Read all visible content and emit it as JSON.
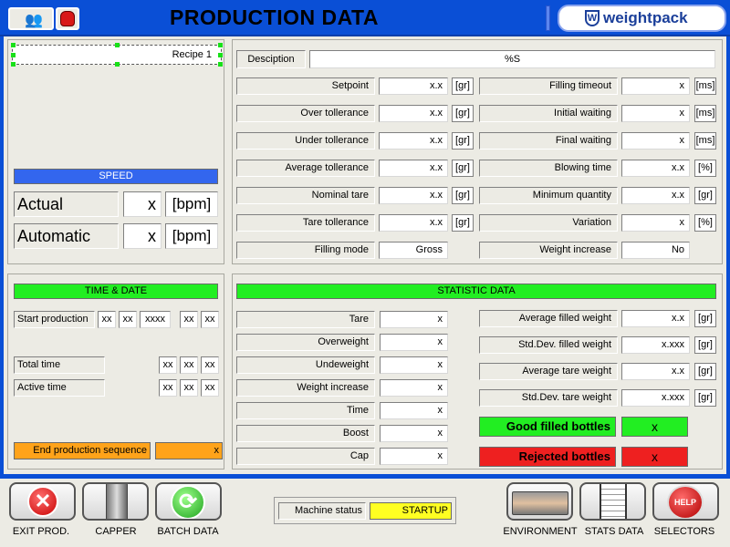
{
  "header": {
    "title": "PRODUCTION DATA",
    "logo": "weightpack"
  },
  "recipe": {
    "value": "Recipe 1"
  },
  "speed": {
    "title": "SPEED",
    "actual_label": "Actual",
    "actual_value": "x",
    "actual_unit": "[bpm]",
    "automatic_label": "Automatic",
    "automatic_value": "x",
    "automatic_unit": "[bpm]"
  },
  "timedate": {
    "title": "TIME & DATE",
    "start_label": "Start production",
    "start_values": [
      "xx",
      "xx",
      "xxxx",
      "xx",
      "xx"
    ],
    "total_label": "Total time",
    "total_values": [
      "xx",
      "xx",
      "xx"
    ],
    "active_label": "Active time",
    "active_values": [
      "xx",
      "xx",
      "xx"
    ],
    "end_label": "End production sequence",
    "end_value": "x"
  },
  "params": {
    "description_label": "Desciption",
    "description_value": "%S",
    "left": [
      {
        "label": "Setpoint",
        "value": "x.x",
        "unit": "[gr]"
      },
      {
        "label": "Over tollerance",
        "value": "x.x",
        "unit": "[gr]"
      },
      {
        "label": "Under tollerance",
        "value": "x.x",
        "unit": "[gr]"
      },
      {
        "label": "Average tollerance",
        "value": "x.x",
        "unit": "[gr]"
      },
      {
        "label": "Nominal tare",
        "value": "x.x",
        "unit": "[gr]"
      },
      {
        "label": "Tare tollerance",
        "value": "x.x",
        "unit": "[gr]"
      },
      {
        "label": "Filling mode",
        "value": "Gross",
        "unit": ""
      }
    ],
    "right": [
      {
        "label": "Filling timeout",
        "value": "x",
        "unit": "[ms]"
      },
      {
        "label": "Initial waiting",
        "value": "x",
        "unit": "[ms]"
      },
      {
        "label": "Final waiting",
        "value": "x",
        "unit": "[ms]"
      },
      {
        "label": "Blowing time",
        "value": "x.x",
        "unit": "[%]"
      },
      {
        "label": "Minimum quantity",
        "value": "x.x",
        "unit": "[gr]"
      },
      {
        "label": "Variation",
        "value": "x",
        "unit": "[%]"
      },
      {
        "label": "Weight increase",
        "value": "No",
        "unit": ""
      }
    ]
  },
  "stats": {
    "title": "STATISTIC DATA",
    "left": [
      {
        "label": "Tare",
        "value": "x"
      },
      {
        "label": "Overweight",
        "value": "x"
      },
      {
        "label": "Undeweight",
        "value": "x"
      },
      {
        "label": "Weight increase",
        "value": "x"
      },
      {
        "label": "Time",
        "value": "x"
      },
      {
        "label": "Boost",
        "value": "x"
      },
      {
        "label": "Cap",
        "value": "x"
      }
    ],
    "right": [
      {
        "label": "Average filled weight",
        "value": "x.x",
        "unit": "[gr]"
      },
      {
        "label": "Std.Dev. filled weight",
        "value": "x.xxx",
        "unit": "[gr]"
      },
      {
        "label": "Average tare weight",
        "value": "x.x",
        "unit": "[gr]"
      },
      {
        "label": "Std.Dev. tare weight",
        "value": "x.xxx",
        "unit": "[gr]"
      }
    ],
    "good_label": "Good filled bottles",
    "good_value": "x",
    "rejected_label": "Rejected bottles",
    "rejected_value": "x"
  },
  "footer": {
    "exit_label": "EXIT PROD.",
    "capper_label": "CAPPER",
    "batch_label": "BATCH DATA",
    "status_label": "Machine status",
    "status_value": "STARTUP",
    "environment_label": "ENVIRONMENT",
    "stats_label": "STATS DATA",
    "selectors_label": "SELECTORS"
  },
  "colors": {
    "accent": "#0a4fd6",
    "blue_bar": "#3366ee",
    "green": "#22ee22",
    "orange": "#ffa31a",
    "red": "#ee2020",
    "yellow": "#ffff22"
  }
}
